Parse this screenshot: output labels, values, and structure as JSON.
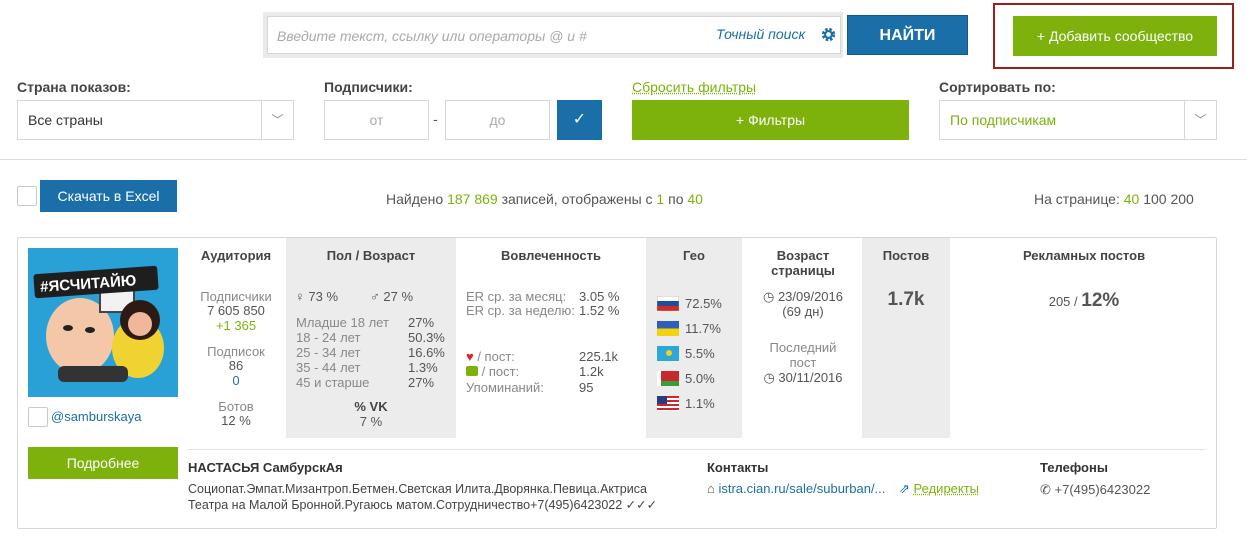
{
  "search": {
    "placeholder": "Введите текст, ссылку или операторы @ и #",
    "exact_label": "Точный поиск",
    "find_label": "НАЙТИ"
  },
  "add_button": "+ Добавить сообщество",
  "filters": {
    "country_label": "Страна показов:",
    "country_value": "Все страны",
    "subs_label": "Подписчики:",
    "from_placeholder": "от",
    "dash": "-",
    "to_placeholder": "до",
    "apply_glyph": "✓",
    "reset_label": "Сбросить фильтры",
    "more_filters_label": "+ Фильтры",
    "sort_label": "Сортировать по:",
    "sort_value": "По подписчикам"
  },
  "toolbar": {
    "excel_label": "Скачать в Excel",
    "found_prefix": "Найдено ",
    "found_count": "187 869",
    "found_mid": " записей, отображены с ",
    "found_from": "1",
    "found_to_word": " по ",
    "found_to": "40",
    "per_page_label": "На странице: ",
    "per_page_options": [
      "40",
      "100",
      "200"
    ]
  },
  "card": {
    "avatar_text": "#ЯСЧИТАЙЮ",
    "handle": "@samburskaya",
    "more_label": "Подробнее",
    "audience": {
      "header": "Аудитория",
      "subs_label": "Подписчики",
      "subs_value": "7 605 850",
      "subs_delta": "+1 365",
      "follows_label": "Подписок",
      "follows_value": "86",
      "follows_extra": "0",
      "bots_label": "Ботов",
      "bots_value": "12 %"
    },
    "gender_age": {
      "header": "Пол / Возраст",
      "female": "73 %",
      "male": "27 %",
      "ages": [
        {
          "label": "Младше 18 лет",
          "value": "27%"
        },
        {
          "label": "18 - 24 лет",
          "value": "50.3%"
        },
        {
          "label": "25 - 34 лет",
          "value": "16.6%"
        },
        {
          "label": "35 - 44 лет",
          "value": "1.3%"
        },
        {
          "label": "45 и старше",
          "value": "27%"
        }
      ],
      "vk_label": "% VK",
      "vk_value": "7 %"
    },
    "engagement": {
      "header": "Вовлеченность",
      "er_month_label": "ER ср. за месяц:",
      "er_month_value": "3.05 %",
      "er_week_label": "ER ср. за неделю:",
      "er_week_value": "1.52 %",
      "likes_label": " / пост:",
      "likes_value": "225.1k",
      "comments_label": " / пост:",
      "comments_value": "1.2k",
      "mentions_label": "Упоминаний:",
      "mentions_value": "95"
    },
    "geo": {
      "header": "Гео",
      "items": [
        {
          "flag": "ru",
          "value": "72.5%"
        },
        {
          "flag": "ua",
          "value": "11.7%"
        },
        {
          "flag": "kz",
          "value": "5.5%"
        },
        {
          "flag": "by",
          "value": "5.0%"
        },
        {
          "flag": "us",
          "value": "1.1%"
        }
      ]
    },
    "page_age": {
      "header": "Возраст страницы",
      "created": "23/09/2016",
      "days": "(69 дн)",
      "last_post_label": "Последний пост",
      "last_post": "30/11/2016"
    },
    "posts": {
      "header": "Постов",
      "value": "1.7k"
    },
    "ad_posts": {
      "header": "Рекламных постов",
      "count": "205 / ",
      "percent": "12%"
    },
    "name": "НАСТАСЬЯ СамбурскАя",
    "description_line1": "Социопат.Эмпат.Мизантроп.Бетмен.Светская Илита.Дворянка.Певица.Актриса",
    "description_line2": "Театра на Малой Бронной.Ругаюсь матом.Сотрудничество+7(495)6423022 ✓✓✓",
    "contacts_title": "Контакты",
    "contacts_link": "istra.cian.ru/sale/suburban/...",
    "redirects_label": "Редиректы",
    "phones_title": "Телефоны",
    "phone": "+7(495)6423022"
  },
  "colors": {
    "blue": "#1a6fa8",
    "green": "#7db20d",
    "highlight_frame": "#a21c1c"
  }
}
